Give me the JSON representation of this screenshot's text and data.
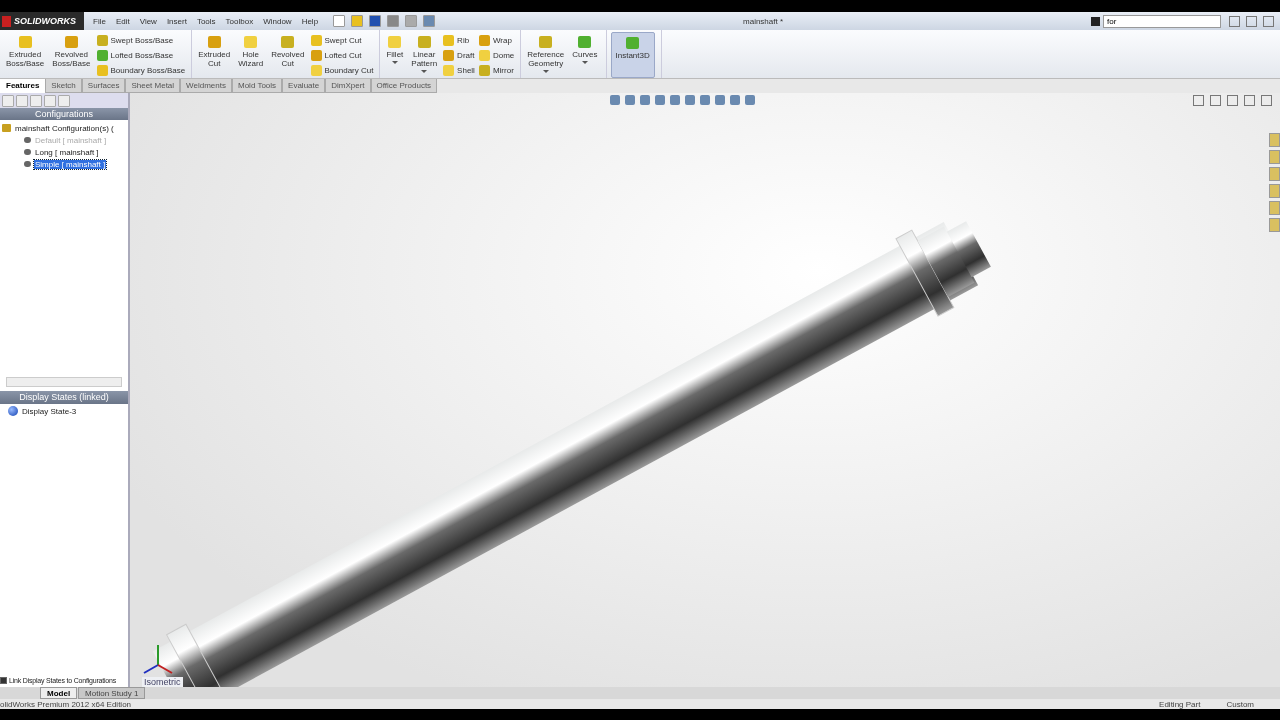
{
  "titlebar": {
    "logo": "SOLIDWORKS",
    "menu": [
      "File",
      "Edit",
      "View",
      "Insert",
      "Tools",
      "Toolbox",
      "Window",
      "Help"
    ],
    "title": "mainshaft *",
    "search": {
      "value": "for"
    }
  },
  "ribbon": {
    "groups": [
      {
        "columns": [
          {
            "kind": "large",
            "lines": [
              "Extruded",
              "Boss/Base"
            ],
            "dropdown": false
          },
          {
            "kind": "large",
            "lines": [
              "Revolved",
              "Boss/Base"
            ],
            "dropdown": false
          },
          {
            "kind": "stack",
            "items": [
              "Swept Boss/Base",
              "Lofted Boss/Base",
              "Boundary Boss/Base"
            ]
          }
        ]
      },
      {
        "columns": [
          {
            "kind": "large",
            "lines": [
              "Extruded",
              "Cut"
            ],
            "dropdown": false
          },
          {
            "kind": "large",
            "lines": [
              "Hole",
              "Wizard"
            ],
            "dropdown": false
          },
          {
            "kind": "large",
            "lines": [
              "Revolved",
              "Cut"
            ],
            "dropdown": false
          },
          {
            "kind": "stack",
            "items": [
              "Swept Cut",
              "Lofted Cut",
              "Boundary Cut"
            ]
          }
        ]
      },
      {
        "columns": [
          {
            "kind": "large",
            "lines": [
              "Fillet"
            ],
            "dropdown": true
          },
          {
            "kind": "large",
            "lines": [
              "Linear",
              "Pattern"
            ],
            "dropdown": true
          },
          {
            "kind": "stack",
            "items": [
              "Rib",
              "Draft",
              "Shell"
            ]
          },
          {
            "kind": "stack",
            "items": [
              "Wrap",
              "Dome",
              "Mirror"
            ]
          }
        ]
      },
      {
        "columns": [
          {
            "kind": "large",
            "lines": [
              "Reference",
              "Geometry"
            ],
            "dropdown": true
          },
          {
            "kind": "large",
            "lines": [
              "Curves"
            ],
            "dropdown": true
          }
        ]
      },
      {
        "columns": [
          {
            "kind": "toggle",
            "lines": [
              "Instant3D"
            ],
            "selected": true
          }
        ]
      }
    ]
  },
  "tabs": [
    {
      "label": "Features",
      "selected": true
    },
    {
      "label": "Sketch",
      "selected": false
    },
    {
      "label": "Surfaces",
      "selected": false
    },
    {
      "label": "Sheet Metal",
      "selected": false
    },
    {
      "label": "Weldments",
      "selected": false
    },
    {
      "label": "Mold Tools",
      "selected": false
    },
    {
      "label": "Evaluate",
      "selected": false
    },
    {
      "label": "DimXpert",
      "selected": false
    },
    {
      "label": "Office Products",
      "selected": false
    }
  ],
  "panel": {
    "heading": "Configurations",
    "tree": {
      "label": "mainshaft Configuration(s) (",
      "children": [
        {
          "label": "Default [ mainshaft ]",
          "disabled": true,
          "selected": false
        },
        {
          "label": "Long [ mainshaft ]",
          "disabled": false,
          "selected": false
        },
        {
          "label": "Simple [ mainshaft ]",
          "disabled": false,
          "selected": true
        }
      ]
    },
    "display_heading": "Display States (linked)",
    "display_state": "Display State-3",
    "link_checkbox": {
      "label": "Link Display States to Configurations",
      "checked": true
    }
  },
  "viewport": {
    "view_label": "Isometric"
  },
  "bottom_tabs": [
    {
      "label": "Model",
      "selected": true
    },
    {
      "label": "Motion Study 1",
      "selected": false
    }
  ],
  "status_bar": [
    "olidWorks Premium 2012 x64 Edition",
    "Editing Part",
    "Custom"
  ]
}
